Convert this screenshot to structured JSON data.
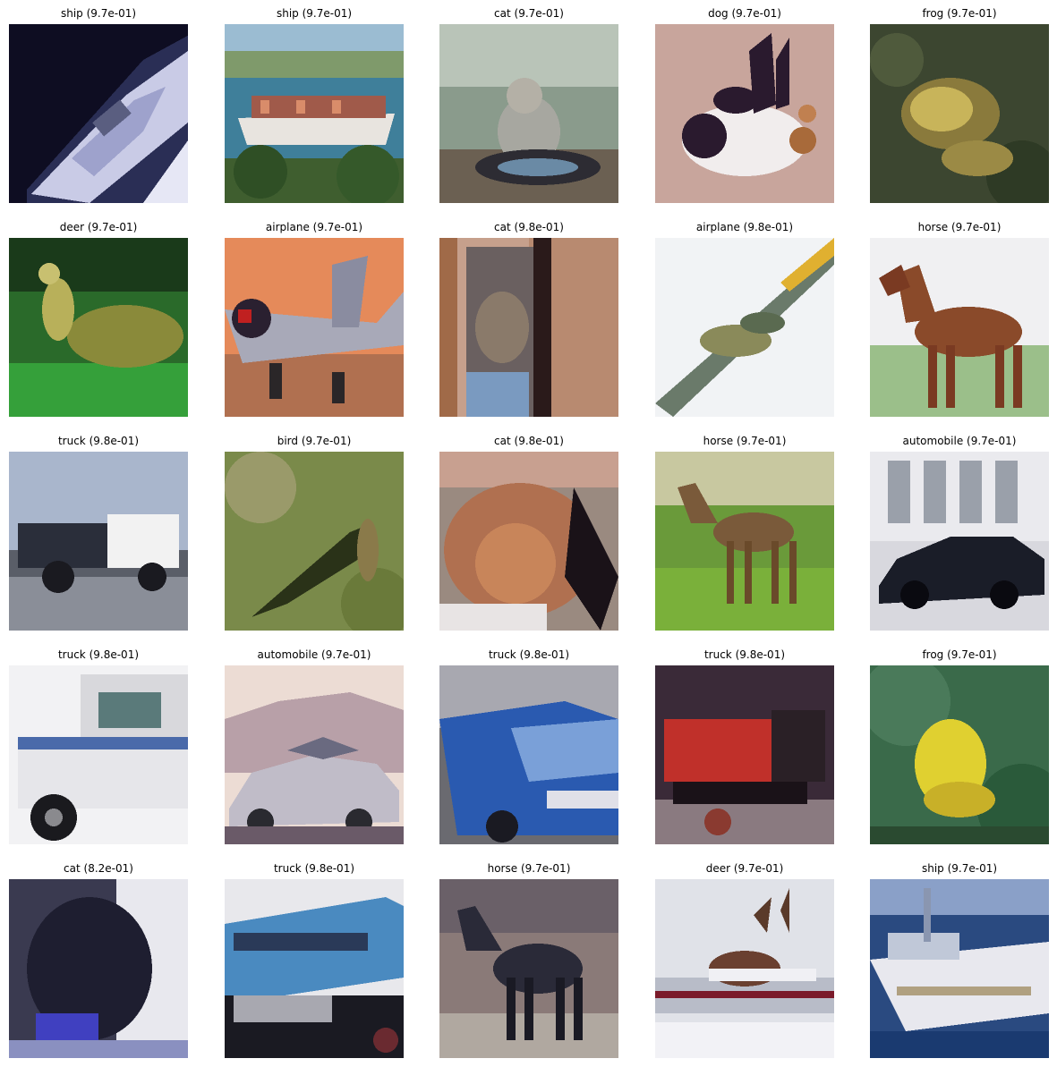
{
  "grid": {
    "rows": 5,
    "columns": 5,
    "items": [
      {
        "label": "ship",
        "score": "9.7e-01",
        "caption": "ship (9.7e-01)",
        "scene": "ship-dark"
      },
      {
        "label": "ship",
        "score": "9.7e-01",
        "caption": "ship (9.7e-01)",
        "scene": "container-ship"
      },
      {
        "label": "cat",
        "score": "9.7e-01",
        "caption": "cat (9.7e-01)",
        "scene": "cat-grey"
      },
      {
        "label": "dog",
        "score": "9.7e-01",
        "caption": "dog (9.7e-01)",
        "scene": "dog-bw"
      },
      {
        "label": "frog",
        "score": "9.7e-01",
        "caption": "frog (9.7e-01)",
        "scene": "frog-brown"
      },
      {
        "label": "deer",
        "score": "9.7e-01",
        "caption": "deer (9.7e-01)",
        "scene": "deer-green"
      },
      {
        "label": "airplane",
        "score": "9.7e-01",
        "caption": "airplane (9.7e-01)",
        "scene": "airplane-orange"
      },
      {
        "label": "cat",
        "score": "9.8e-01",
        "caption": "cat (9.8e-01)",
        "scene": "cat-door"
      },
      {
        "label": "airplane",
        "score": "9.8e-01",
        "caption": "airplane (9.8e-01)",
        "scene": "airplane-white"
      },
      {
        "label": "horse",
        "score": "9.7e-01",
        "caption": "horse (9.7e-01)",
        "scene": "horse-brown"
      },
      {
        "label": "truck",
        "score": "9.8e-01",
        "caption": "truck (9.8e-01)",
        "scene": "truck-dump"
      },
      {
        "label": "bird",
        "score": "9.7e-01",
        "caption": "bird (9.7e-01)",
        "scene": "bird-grass"
      },
      {
        "label": "cat",
        "score": "9.8e-01",
        "caption": "cat (9.8e-01)",
        "scene": "cat-orange"
      },
      {
        "label": "horse",
        "score": "9.7e-01",
        "caption": "horse (9.7e-01)",
        "scene": "horse-field"
      },
      {
        "label": "automobile",
        "score": "9.7e-01",
        "caption": "automobile (9.7e-01)",
        "scene": "car-black"
      },
      {
        "label": "truck",
        "score": "9.8e-01",
        "caption": "truck (9.8e-01)",
        "scene": "truck-white"
      },
      {
        "label": "automobile",
        "score": "9.7e-01",
        "caption": "automobile (9.7e-01)",
        "scene": "car-silver"
      },
      {
        "label": "truck",
        "score": "9.8e-01",
        "caption": "truck (9.8e-01)",
        "scene": "truck-blue"
      },
      {
        "label": "truck",
        "score": "9.8e-01",
        "caption": "truck (9.8e-01)",
        "scene": "truck-red"
      },
      {
        "label": "frog",
        "score": "9.7e-01",
        "caption": "frog (9.7e-01)",
        "scene": "frog-yellow"
      },
      {
        "label": "cat",
        "score": "8.2e-01",
        "caption": "cat (8.2e-01)",
        "scene": "cat-window"
      },
      {
        "label": "truck",
        "score": "9.8e-01",
        "caption": "truck (9.8e-01)",
        "scene": "truck-container"
      },
      {
        "label": "horse",
        "score": "9.7e-01",
        "caption": "horse (9.7e-01)",
        "scene": "horse-dark"
      },
      {
        "label": "deer",
        "score": "9.7e-01",
        "caption": "deer (9.7e-01)",
        "scene": "deer-snow"
      },
      {
        "label": "ship",
        "score": "9.7e-01",
        "caption": "ship (9.7e-01)",
        "scene": "ship-white"
      }
    ]
  }
}
